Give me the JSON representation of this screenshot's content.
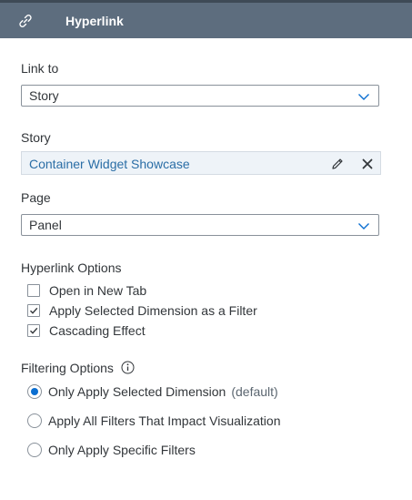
{
  "header": {
    "title": "Hyperlink",
    "icon": "link-icon"
  },
  "link_to": {
    "label": "Link to",
    "value": "Story"
  },
  "story": {
    "label": "Story",
    "value": "Container Widget Showcase"
  },
  "page": {
    "label": "Page",
    "value": "Panel"
  },
  "hyperlink_options": {
    "label": "Hyperlink Options",
    "items": [
      {
        "label": "Open in New Tab",
        "checked": false
      },
      {
        "label": "Apply Selected Dimension as a Filter",
        "checked": true
      },
      {
        "label": "Cascading Effect",
        "checked": true
      }
    ]
  },
  "filtering_options": {
    "label": "Filtering Options",
    "items": [
      {
        "label": "Only Apply Selected Dimension",
        "hint": "(default)",
        "selected": true
      },
      {
        "label": "Apply All Filters That Impact Visualization",
        "hint": "",
        "selected": false
      },
      {
        "label": "Only Apply Specific Filters",
        "hint": "",
        "selected": false
      }
    ]
  },
  "colors": {
    "header_bg": "#5d6d7e",
    "accent": "#0a6ed1",
    "link": "#2b6ea6"
  }
}
